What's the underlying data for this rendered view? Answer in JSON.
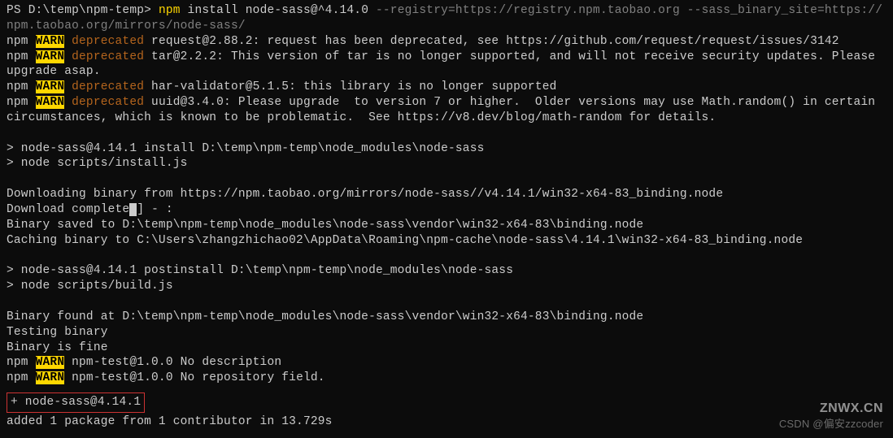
{
  "prompt": {
    "ps": "PS D:\\temp\\npm-temp> ",
    "cmd": "npm",
    "args_white": " install node-sass@^4.14.0 ",
    "args_grey": "--registry=https://registry.npm.taobao.org --sass_binary_site=https://npm.taobao.org/mirrors/node-sass/"
  },
  "warn_lines": [
    {
      "prefix": "npm ",
      "warn": "WARN",
      "mid": " ",
      "dep": "deprecated",
      "rest": " request@2.88.2: request has been deprecated, see https://github.com/request/request/issues/3142"
    },
    {
      "prefix": "npm ",
      "warn": "WARN",
      "mid": " ",
      "dep": "deprecated",
      "rest": " tar@2.2.2: This version of tar is no longer supported, and will not receive security updates. Please upgrade asap."
    },
    {
      "prefix": "npm ",
      "warn": "WARN",
      "mid": " ",
      "dep": "deprecated",
      "rest": " har-validator@5.1.5: this library is no longer supported"
    },
    {
      "prefix": "npm ",
      "warn": "WARN",
      "mid": " ",
      "dep": "deprecated",
      "rest": " uuid@3.4.0: Please upgrade  to version 7 or higher.  Older versions may use Math.random() in certain circumstances, which is known to be problematic.  See https://v8.dev/blog/math-random for details."
    }
  ],
  "install_header": "> node-sass@4.14.1 install D:\\temp\\npm-temp\\node_modules\\node-sass",
  "install_script": "> node scripts/install.js",
  "download_lines": [
    "Downloading binary from https://npm.taobao.org/mirrors/node-sass//v4.14.1/win32-x64-83_binding.node",
    "Download complete",
    "Binary saved to D:\\temp\\npm-temp\\node_modules\\node-sass\\vendor\\win32-x64-83\\binding.node",
    "Caching binary to C:\\Users\\zhangzhichao02\\AppData\\Roaming\\npm-cache\\node-sass\\4.14.1\\win32-x64-83_binding.node"
  ],
  "download_suffix": "] - :",
  "postinstall_header": "> node-sass@4.14.1 postinstall D:\\temp\\npm-temp\\node_modules\\node-sass",
  "postinstall_script": "> node scripts/build.js",
  "binary_lines": [
    "Binary found at D:\\temp\\npm-temp\\node_modules\\node-sass\\vendor\\win32-x64-83\\binding.node",
    "Testing binary",
    "Binary is fine"
  ],
  "warn_tail": [
    {
      "prefix": "npm ",
      "warn": "WARN",
      "rest": " npm-test@1.0.0 No description"
    },
    {
      "prefix": "npm ",
      "warn": "WARN",
      "rest": " npm-test@1.0.0 No repository field."
    }
  ],
  "result_box": "+ node-sass@4.14.1",
  "added_line": "added 1 package from 1 contributor in 13.729s",
  "watermark": {
    "logo": "ZNWX.CN",
    "text": "CSDN @偏安zzcoder"
  }
}
